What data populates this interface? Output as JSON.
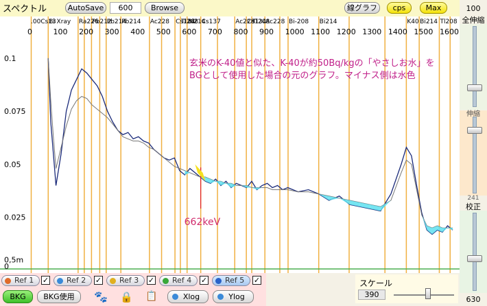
{
  "toolbar": {
    "title": "スペクトル",
    "autosave_label": "AutoSave",
    "count_value": "600",
    "browse_label": "Browse",
    "line_graph_label": "線グラフ",
    "cps_label": "cps",
    "max_label": "Max"
  },
  "right_panel": {
    "top_value": "100",
    "all_scale_label": "全伸縮",
    "mid_label": "伸縮",
    "partial_label": "241",
    "calib_label": "校正",
    "bottom_value": "630"
  },
  "chart_data": {
    "type": "line",
    "xlabel": "",
    "ylabel": "",
    "x_ticks": [
      "0",
      "100",
      "200",
      "300",
      "400",
      "500",
      "600",
      "700",
      "800",
      "900",
      "1000",
      "1100",
      "1200",
      "1300",
      "1400",
      "1500",
      "1600"
    ],
    "y_ticks": [
      "0.1",
      "0.075",
      "0.05",
      "0.025",
      "0,5m",
      "0"
    ],
    "xlim": [
      0,
      1640
    ],
    "ylim": [
      0,
      0.11
    ],
    "annotation": "玄米のK-40値と似た、K-40が約50Bq/kgの「やさしお水」をBGとして使用した場合の元のグラフ。マイナス側は水色",
    "marker_label": "662keV",
    "marker_x": 662,
    "nuclide_labels": [
      {
        "text": ".00Cs13",
        "x": 0
      },
      {
        "text": "Bi",
        "x": 70
      },
      {
        "text": "Xray",
        "x": 100
      },
      {
        "text": "Ra226",
        "x": 186
      },
      {
        "text": "Pb212",
        "x": 238
      },
      {
        "text": "Pb214",
        "x": 295
      },
      {
        "text": "Pb214",
        "x": 352
      },
      {
        "text": "Ac228",
        "x": 463
      },
      {
        "text": "Cs134",
        "x": 562
      },
      {
        "text": "Tl208",
        "x": 583
      },
      {
        "text": "Bi214",
        "x": 609
      },
      {
        "text": "Cs137",
        "x": 662
      },
      {
        "text": "Ac228",
        "x": 794
      },
      {
        "text": "Cs134",
        "x": 839
      },
      {
        "text": "Tl208",
        "x": 860
      },
      {
        "text": "Ac228",
        "x": 911
      },
      {
        "text": "Bi-208",
        "x": 1001
      },
      {
        "text": "Bi214",
        "x": 1120
      },
      {
        "text": "K40",
        "x": 1460
      },
      {
        "text": "Bi214",
        "x": 1510
      },
      {
        "text": "Tl208",
        "x": 1588
      }
    ],
    "peak_lines_keV": [
      4,
      70,
      186,
      210,
      238,
      270,
      295,
      352,
      463,
      510,
      562,
      583,
      609,
      662,
      727,
      794,
      839,
      860,
      911,
      969,
      1001,
      1120,
      1238,
      1377,
      1460,
      1510,
      1588,
      1630
    ],
    "series": [
      {
        "name": "",
        "color": "#1a2a7a",
        "x": [
          70,
          80,
          90,
          100,
          120,
          140,
          160,
          180,
          200,
          220,
          240,
          260,
          280,
          300,
          320,
          340,
          360,
          380,
          400,
          420,
          440,
          460,
          480,
          500,
          520,
          540,
          560,
          580,
          600,
          620,
          640,
          660,
          680,
          700,
          720,
          740,
          760,
          780,
          800,
          820,
          840,
          860,
          880,
          900,
          920,
          940,
          960,
          980,
          1000,
          1040,
          1080,
          1120,
          1160,
          1200,
          1240,
          1280,
          1320,
          1360,
          1400,
          1440,
          1460,
          1480,
          1500,
          1520,
          1540,
          1560,
          1580,
          1600,
          1620,
          1640
        ],
        "values": [
          0.1,
          0.07,
          0.055,
          0.04,
          0.055,
          0.075,
          0.085,
          0.09,
          0.095,
          0.093,
          0.09,
          0.087,
          0.082,
          0.075,
          0.07,
          0.066,
          0.064,
          0.065,
          0.062,
          0.063,
          0.061,
          0.06,
          0.057,
          0.055,
          0.053,
          0.052,
          0.053,
          0.047,
          0.045,
          0.048,
          0.046,
          0.044,
          0.042,
          0.041,
          0.043,
          0.04,
          0.042,
          0.039,
          0.041,
          0.04,
          0.039,
          0.042,
          0.038,
          0.04,
          0.041,
          0.039,
          0.04,
          0.038,
          0.039,
          0.037,
          0.038,
          0.036,
          0.033,
          0.035,
          0.031,
          0.03,
          0.029,
          0.028,
          0.036,
          0.05,
          0.058,
          0.054,
          0.04,
          0.027,
          0.019,
          0.017,
          0.019,
          0.018,
          0.021,
          0.019
        ]
      },
      {
        "name": "",
        "color": "#777777",
        "x": [
          70,
          80,
          90,
          100,
          120,
          140,
          160,
          180,
          200,
          220,
          240,
          260,
          280,
          300,
          320,
          340,
          360,
          380,
          400,
          420,
          440,
          460,
          480,
          500,
          520,
          540,
          560,
          580,
          600,
          620,
          640,
          660,
          680,
          700,
          720,
          740,
          760,
          780,
          800,
          820,
          840,
          860,
          880,
          900,
          920,
          940,
          960,
          980,
          1000,
          1040,
          1080,
          1120,
          1160,
          1200,
          1240,
          1280,
          1320,
          1360,
          1400,
          1440,
          1460,
          1480,
          1500,
          1520,
          1540,
          1560,
          1580,
          1600,
          1620,
          1640
        ],
        "values": [
          0.1,
          0.08,
          0.063,
          0.048,
          0.058,
          0.068,
          0.076,
          0.08,
          0.082,
          0.081,
          0.078,
          0.076,
          0.074,
          0.072,
          0.069,
          0.066,
          0.063,
          0.062,
          0.061,
          0.061,
          0.06,
          0.058,
          0.057,
          0.055,
          0.053,
          0.051,
          0.049,
          0.048,
          0.047,
          0.046,
          0.045,
          0.044,
          0.044,
          0.043,
          0.042,
          0.042,
          0.041,
          0.041,
          0.04,
          0.04,
          0.04,
          0.039,
          0.039,
          0.039,
          0.039,
          0.038,
          0.038,
          0.038,
          0.038,
          0.037,
          0.037,
          0.036,
          0.035,
          0.034,
          0.033,
          0.032,
          0.031,
          0.03,
          0.033,
          0.046,
          0.052,
          0.05,
          0.038,
          0.026,
          0.021,
          0.02,
          0.021,
          0.02,
          0.02,
          0.02
        ]
      }
    ]
  },
  "bottom": {
    "refs": [
      {
        "label": "Ref 1",
        "color": "#e06a2a",
        "checked": true
      },
      {
        "label": "Ref 2",
        "color": "#3a8ad8",
        "checked": true
      },
      {
        "label": "Ref 3",
        "color": "#e0b020",
        "checked": true
      },
      {
        "label": "Ref 4",
        "color": "#38a838",
        "checked": true
      },
      {
        "label": "Ref 5",
        "color": "#2a62c8",
        "checked": true
      }
    ],
    "bkg_label": "BKG",
    "bkg_use_label": "BKG使用",
    "xlog_label": "Xlog",
    "ylog_label": "Ylog",
    "scale_label": "スケール",
    "scale_value": "390"
  }
}
